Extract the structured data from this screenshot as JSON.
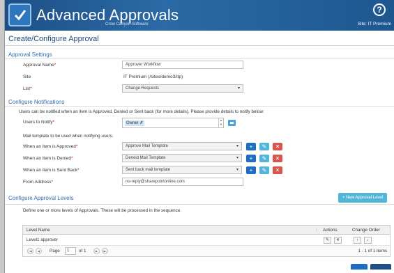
{
  "app": {
    "title": "Advanced Approvals",
    "vendor": "Crow Canyon Software",
    "site_label": "Site: IT Premium",
    "page_title": "Create/Configure Approval"
  },
  "approval_settings": {
    "heading": "Approval Settings",
    "approval_name_label": "Approval Name",
    "approval_name_value": "Approver Workflow",
    "site_label": "Site",
    "site_value": "IT Premium (/sites/demo3/itp)",
    "list_label": "List",
    "list_value": "Change Requests"
  },
  "notifications": {
    "heading": "Configure Notifications",
    "intro": "Users can be notified when an item is Approved, Denied or Sent back (for more details). Please provide details to notify below:",
    "users_label": "Users to Notify",
    "owner_chip": "Owner",
    "mail_intro": "Mail template to be used when notifying users:",
    "approved_label": "When an item is Approved",
    "approved_value": "Approve Mail Template",
    "denied_label": "When an item is Denied",
    "denied_value": "Deneid Mail Template",
    "sentback_label": "When an item is Sent Back",
    "sentback_value": "Sent back mail template",
    "from_label": "From Address",
    "from_value": "no-reply@sharepointonline.com"
  },
  "levels": {
    "heading": "Configure Approval Levels",
    "new_button": "+ New Approval Level",
    "intro": "Define one or more levels of Approvals. These will be processed in the sequence.",
    "columns": [
      "Level Name",
      "Actions",
      "Change Order"
    ],
    "rows": [
      {
        "name": "Level1 approver"
      }
    ],
    "pager": {
      "page_label": "Page",
      "page_value": "1",
      "of_label": "of 1",
      "summary": "1 - 1 of 1 items"
    }
  }
}
